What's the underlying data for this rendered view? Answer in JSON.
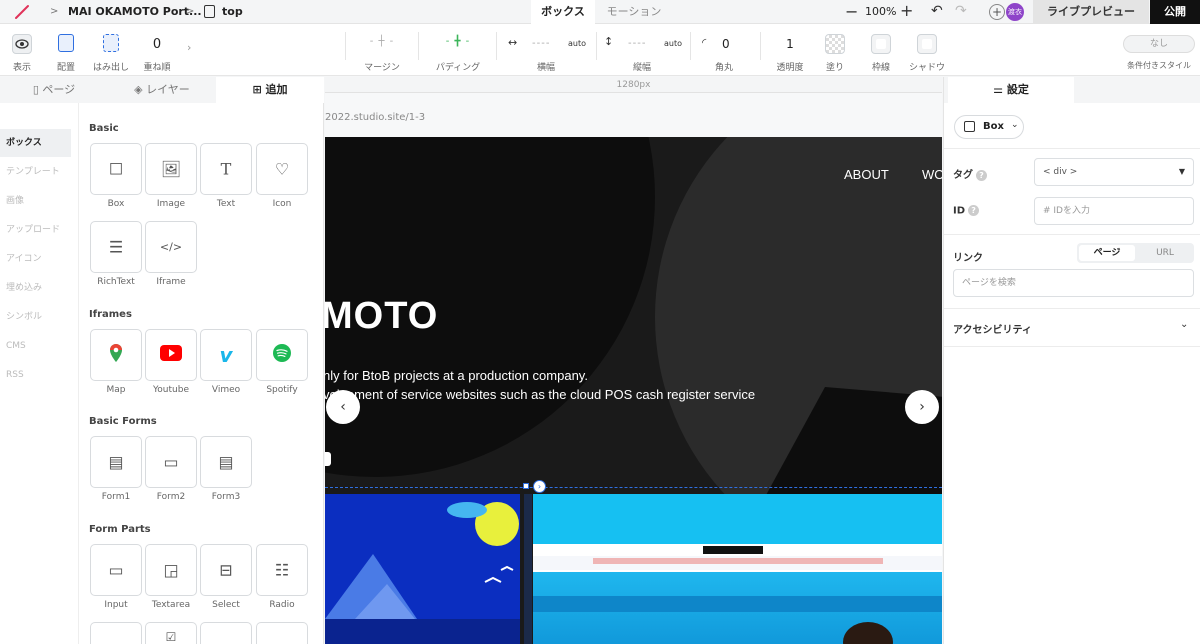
{
  "topbar": {
    "project": "MAI OKAMOTO Port...",
    "page": "top",
    "tabs": {
      "box": "ボックス",
      "motion": "モーション"
    },
    "zoom": "100%",
    "avatar_text": "渡衣",
    "live_preview": "ライブプレビュー",
    "publish": "公開"
  },
  "toolbar": {
    "display": "表示",
    "placement": "配置",
    "overflow": "はみ出し",
    "zorder_value": "0",
    "zorder": "重ね順",
    "margin": "マージン",
    "padding": "パディング",
    "width_value": "----",
    "width_auto": "auto",
    "width": "横幅",
    "height_value": "----",
    "height_auto": "auto",
    "height": "縦幅",
    "radius_value": "0",
    "radius": "角丸",
    "opacity_value": "1",
    "opacity": "透明度",
    "fill": "塗り",
    "border": "枠線",
    "shadow": "シャドウ",
    "conditional_value": "なし",
    "conditional": "条件付きスタイル"
  },
  "left": {
    "tabs": {
      "page": "ページ",
      "layer": "レイヤー",
      "add": "追加"
    },
    "categories": [
      "ボックス",
      "テンプレート",
      "画像",
      "アップロード",
      "アイコン",
      "埋め込み",
      "シンボル",
      "CMS",
      "RSS"
    ],
    "sections": {
      "basic": "Basic",
      "iframes": "Iframes",
      "basic_forms": "Basic Forms",
      "form_parts": "Form Parts"
    },
    "basic_items": [
      "Box",
      "Image",
      "Text",
      "Icon",
      "RichText",
      "Iframe"
    ],
    "iframe_items": [
      "Map",
      "Youtube",
      "Vimeo",
      "Spotify"
    ],
    "form_items": [
      "Form1",
      "Form2",
      "Form3"
    ],
    "part_items": [
      "Input",
      "Textarea",
      "Select",
      "Radio"
    ]
  },
  "canvas": {
    "ruler": "1280px",
    "url": "2022.studio.site/1-3",
    "nav": [
      "ABOUT",
      "WO"
    ],
    "hero_title": "MOTO",
    "hero_p1": "nly for BtoB projects at a production company.",
    "hero_p2": "velopment of service websites such as the cloud POS cash register service",
    "prev": "‹",
    "next": "›"
  },
  "right": {
    "tab": "設定",
    "element": "Box",
    "tag_label": "タグ",
    "tag_value": "< div >",
    "id_label": "ID",
    "id_placeholder": "IDを入力",
    "link_label": "リンク",
    "link_page": "ページ",
    "link_url": "URL",
    "link_search": "ページを検索",
    "accessibility": "アクセシビリティ"
  },
  "colors": {
    "accent": "#2f6fe0",
    "avatar": "#8e44c9",
    "publish": "#111111"
  }
}
